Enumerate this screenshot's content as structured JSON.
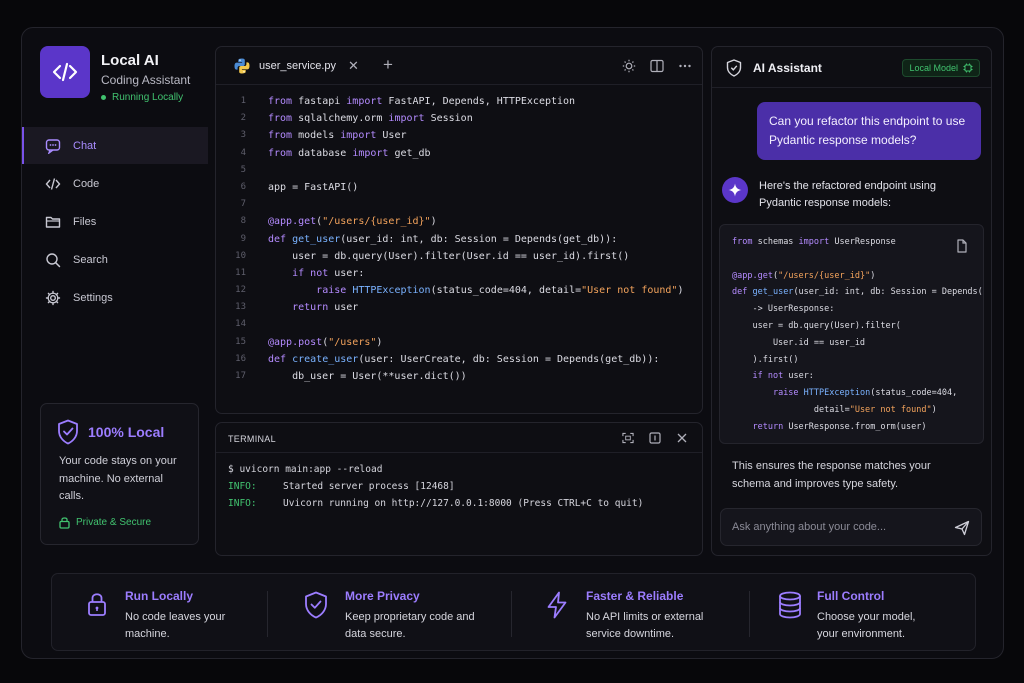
{
  "brand": {
    "title": "Local AI",
    "subtitle": "Coding Assistant",
    "status": "Running Locally",
    "logo_icon": "code-brackets-icon"
  },
  "nav": [
    {
      "label": "Chat",
      "icon": "chat-icon",
      "active": true
    },
    {
      "label": "Code",
      "icon": "code-icon",
      "active": false
    },
    {
      "label": "Files",
      "icon": "folder-icon",
      "active": false
    },
    {
      "label": "Search",
      "icon": "search-icon",
      "active": false
    },
    {
      "label": "Settings",
      "icon": "gear-icon",
      "active": false
    }
  ],
  "local_card": {
    "title": "100% Local",
    "description": "Your code stays on your machine. No external calls.",
    "secure": "Private & Secure"
  },
  "editor": {
    "tab_name": "user_service.py",
    "lines": [
      {
        "n": "1",
        "t": "from fastapi import FastAPI, Depends, HTTPException"
      },
      {
        "n": "2",
        "t": "from sqlalchemy.orm import Session"
      },
      {
        "n": "3",
        "t": "from models import User"
      },
      {
        "n": "4",
        "t": "from database import get_db"
      },
      {
        "n": "5",
        "t": ""
      },
      {
        "n": "6",
        "t": "app = FastAPI()"
      },
      {
        "n": "7",
        "t": ""
      },
      {
        "n": "8",
        "t": "@app.get(\"/users/{user_id}\")"
      },
      {
        "n": "9",
        "t": "def get_user(user_id: int, db: Session = Depends(get_db)):"
      },
      {
        "n": "10",
        "t": "    user = db.query(User).filter(User.id == user_id).first()"
      },
      {
        "n": "11",
        "t": "    if not user:"
      },
      {
        "n": "12",
        "t": "        raise HTTPException(status_code=404, detail=\"User not found\")"
      },
      {
        "n": "13",
        "t": "    return user"
      },
      {
        "n": "14",
        "t": ""
      },
      {
        "n": "15",
        "t": "@app.post(\"/users\")"
      },
      {
        "n": "16",
        "t": "def create_user(user: UserCreate, db: Session = Depends(get_db)):"
      },
      {
        "n": "17",
        "t": "    db_user = User(**user.dict())"
      }
    ]
  },
  "terminal": {
    "title": "TERMINAL",
    "command": "$ uvicorn main:app --reload",
    "logs": [
      {
        "level": "INFO:",
        "msg": "Started server process [12468]"
      },
      {
        "level": "INFO:",
        "msg": "Uvicorn running on http://127.0.0.1:8000 (Press CTRL+C to quit)"
      }
    ]
  },
  "assistant": {
    "title": "AI Assistant",
    "badge": "Local Model",
    "user_message": "Can you refactor this endpoint to use Pydantic response models?",
    "reply_intro": "Here's the refactored endpoint using Pydantic response models:",
    "code_lines": [
      "from schemas import UserResponse",
      "",
      "@app.get(\"/users/{user_id}\")",
      "def get_user(user_id: int, db: Session = Depends(get_db))",
      "    -> UserResponse:",
      "    user = db.query(User).filter(",
      "        User.id == user_id",
      "    ).first()",
      "    if not user:",
      "        raise HTTPException(status_code=404,",
      "                detail=\"User not found\")",
      "    return UserResponse.from_orm(user)"
    ],
    "reply_outro": "This ensures the response matches your schema and improves type safety.",
    "input_placeholder": "Ask anything about your code..."
  },
  "features": [
    {
      "title": "Run Locally",
      "desc": "No code leaves your machine.",
      "icon": "lock-icon"
    },
    {
      "title": "More Privacy",
      "desc": "Keep proprietary code and data secure.",
      "icon": "shield-icon"
    },
    {
      "title": "Faster & Reliable",
      "desc": "No API limits or external service downtime.",
      "icon": "lightning-icon"
    },
    {
      "title": "Full Control",
      "desc": "Choose your model, your environment.",
      "icon": "database-icon"
    }
  ],
  "colors": {
    "accent": "#7a52ea",
    "accent_light": "#9c7dff",
    "success": "#41c26f",
    "string": "#f3a35c",
    "function": "#7ab2ff"
  }
}
